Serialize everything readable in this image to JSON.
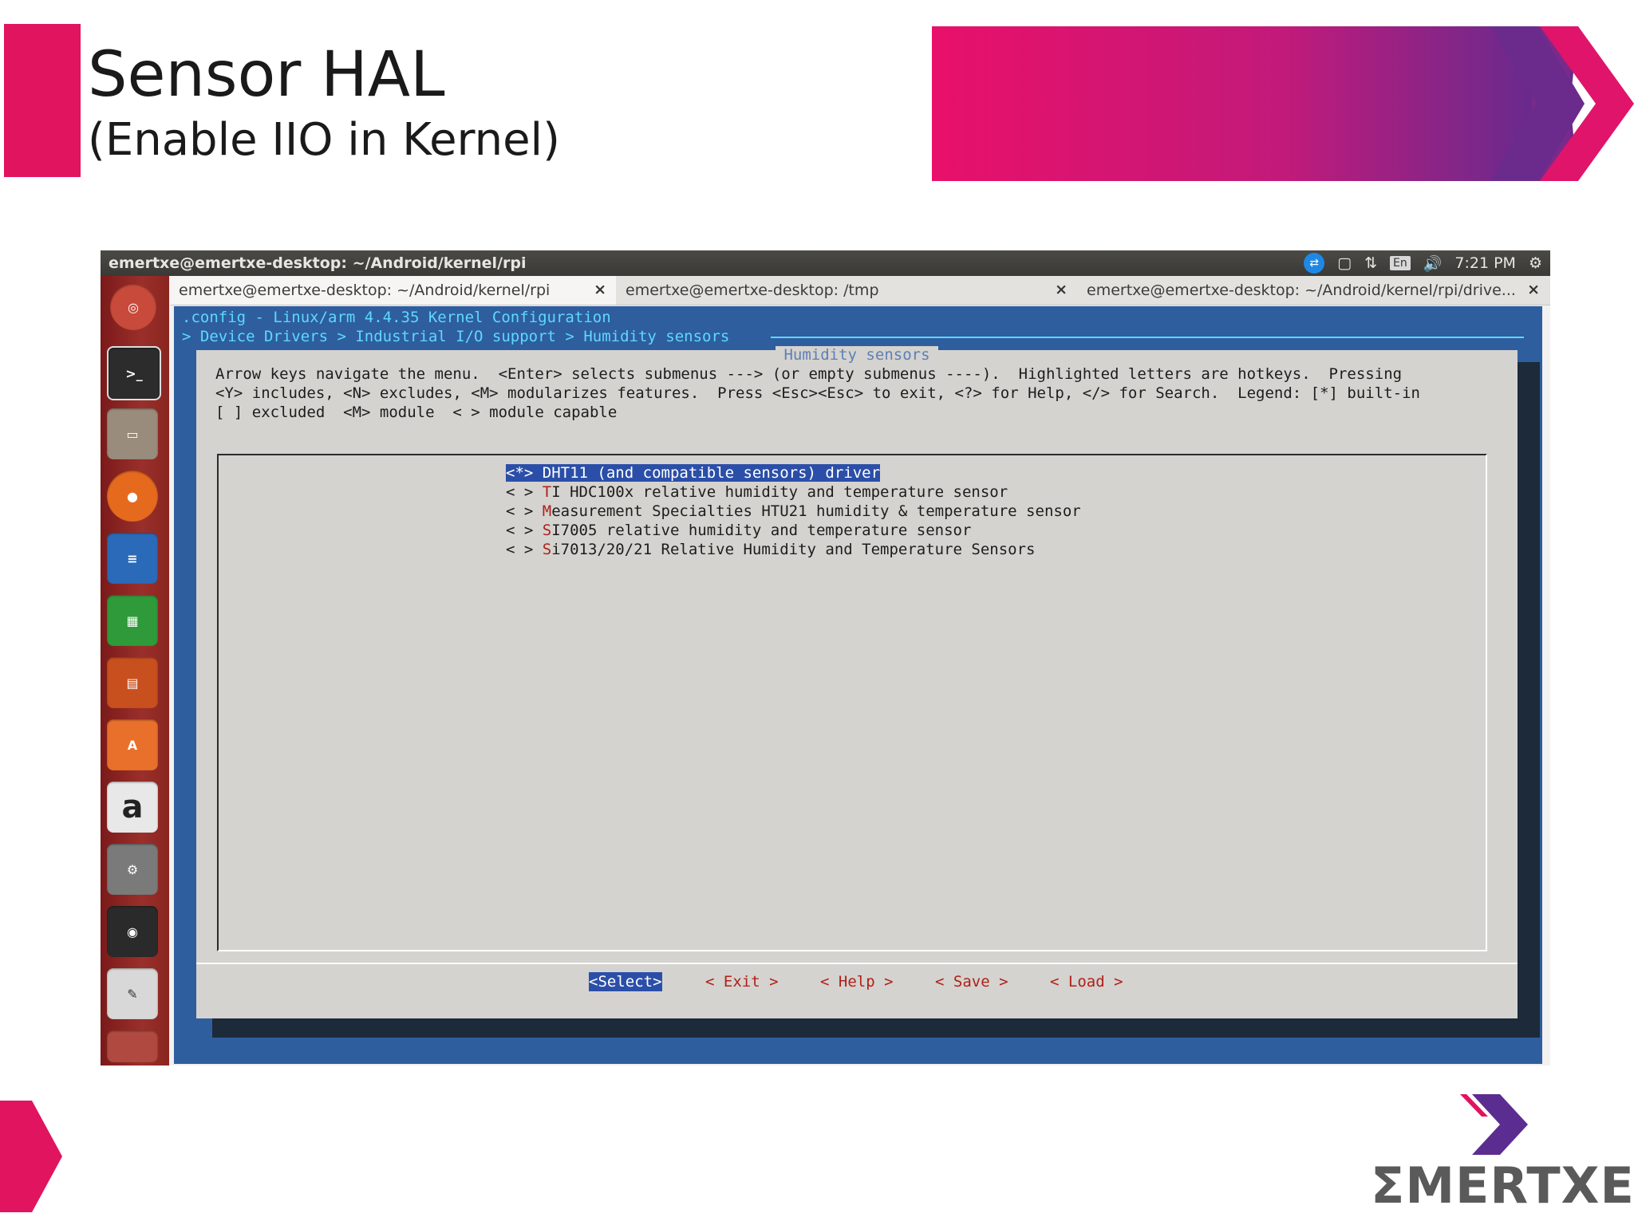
{
  "slide": {
    "title": "Sensor HAL",
    "subtitle": "(Enable IIO in Kernel)",
    "logo_text": "ΣMERTXE"
  },
  "topbar": {
    "window_title": "emertxe@emertxe-desktop: ~/Android/kernel/rpi",
    "indicator_lang": "En",
    "clock": "7:21 PM"
  },
  "launcher": {
    "items": [
      "ubuntu-dash",
      "terminal",
      "files",
      "firefox",
      "writer",
      "calc",
      "impress",
      "software-center",
      "amazon",
      "system-settings",
      "color",
      "text-editor"
    ]
  },
  "tabs": [
    {
      "label": "emertxe@emertxe-desktop: ~/Android/kernel/rpi",
      "close": "×"
    },
    {
      "label": "emertxe@emertxe-desktop: /tmp",
      "close": "×"
    },
    {
      "label": "emertxe@emertxe-desktop: ~/Android/kernel/rpi/drive...",
      "close": "×"
    }
  ],
  "terminal": {
    "header_line1": ".config - Linux/arm 4.4.35 Kernel Configuration",
    "header_line2": "> Device Drivers > Industrial I/O support > Humidity sensors ",
    "dialog_title": "Humidity sensors",
    "help_lines": [
      "Arrow keys navigate the menu.  <Enter> selects submenus ---> (or empty submenus ----).  Highlighted letters are hotkeys.  Pressing",
      "<Y> includes, <N> excludes, <M> modularizes features.  Press <Esc><Esc> to exit, <?> for Help, </> for Search.  Legend: [*] built-in",
      "[ ] excluded  <M> module  < > module capable"
    ],
    "menu_items": [
      {
        "mark": "<*>",
        "hotkey": "D",
        "rest": "HT11 (and compatible sensors) driver",
        "selected": true
      },
      {
        "mark": "< >",
        "hotkey": "T",
        "rest": "I HDC100x relative humidity and temperature sensor",
        "selected": false
      },
      {
        "mark": "< >",
        "hotkey": "M",
        "rest": "easurement Specialties HTU21 humidity & temperature sensor",
        "selected": false
      },
      {
        "mark": "< >",
        "hotkey": "S",
        "rest": "I7005 relative humidity and temperature sensor",
        "selected": false
      },
      {
        "mark": "< >",
        "hotkey": "S",
        "rest": "i7013/20/21 Relative Humidity and Temperature Sensors",
        "selected": false
      }
    ],
    "buttons": [
      "<Select>",
      "< Exit >",
      "< Help >",
      "< Save >",
      "< Load >"
    ]
  },
  "colors": {
    "brand_pink": "#e0145f",
    "brand_purple": "#5b2d90",
    "terminal_blue": "#2e5e9e",
    "dialog_gray": "#d4d3cf",
    "selection_blue": "#2b4fa8",
    "hotkey_red": "#b0201a"
  }
}
